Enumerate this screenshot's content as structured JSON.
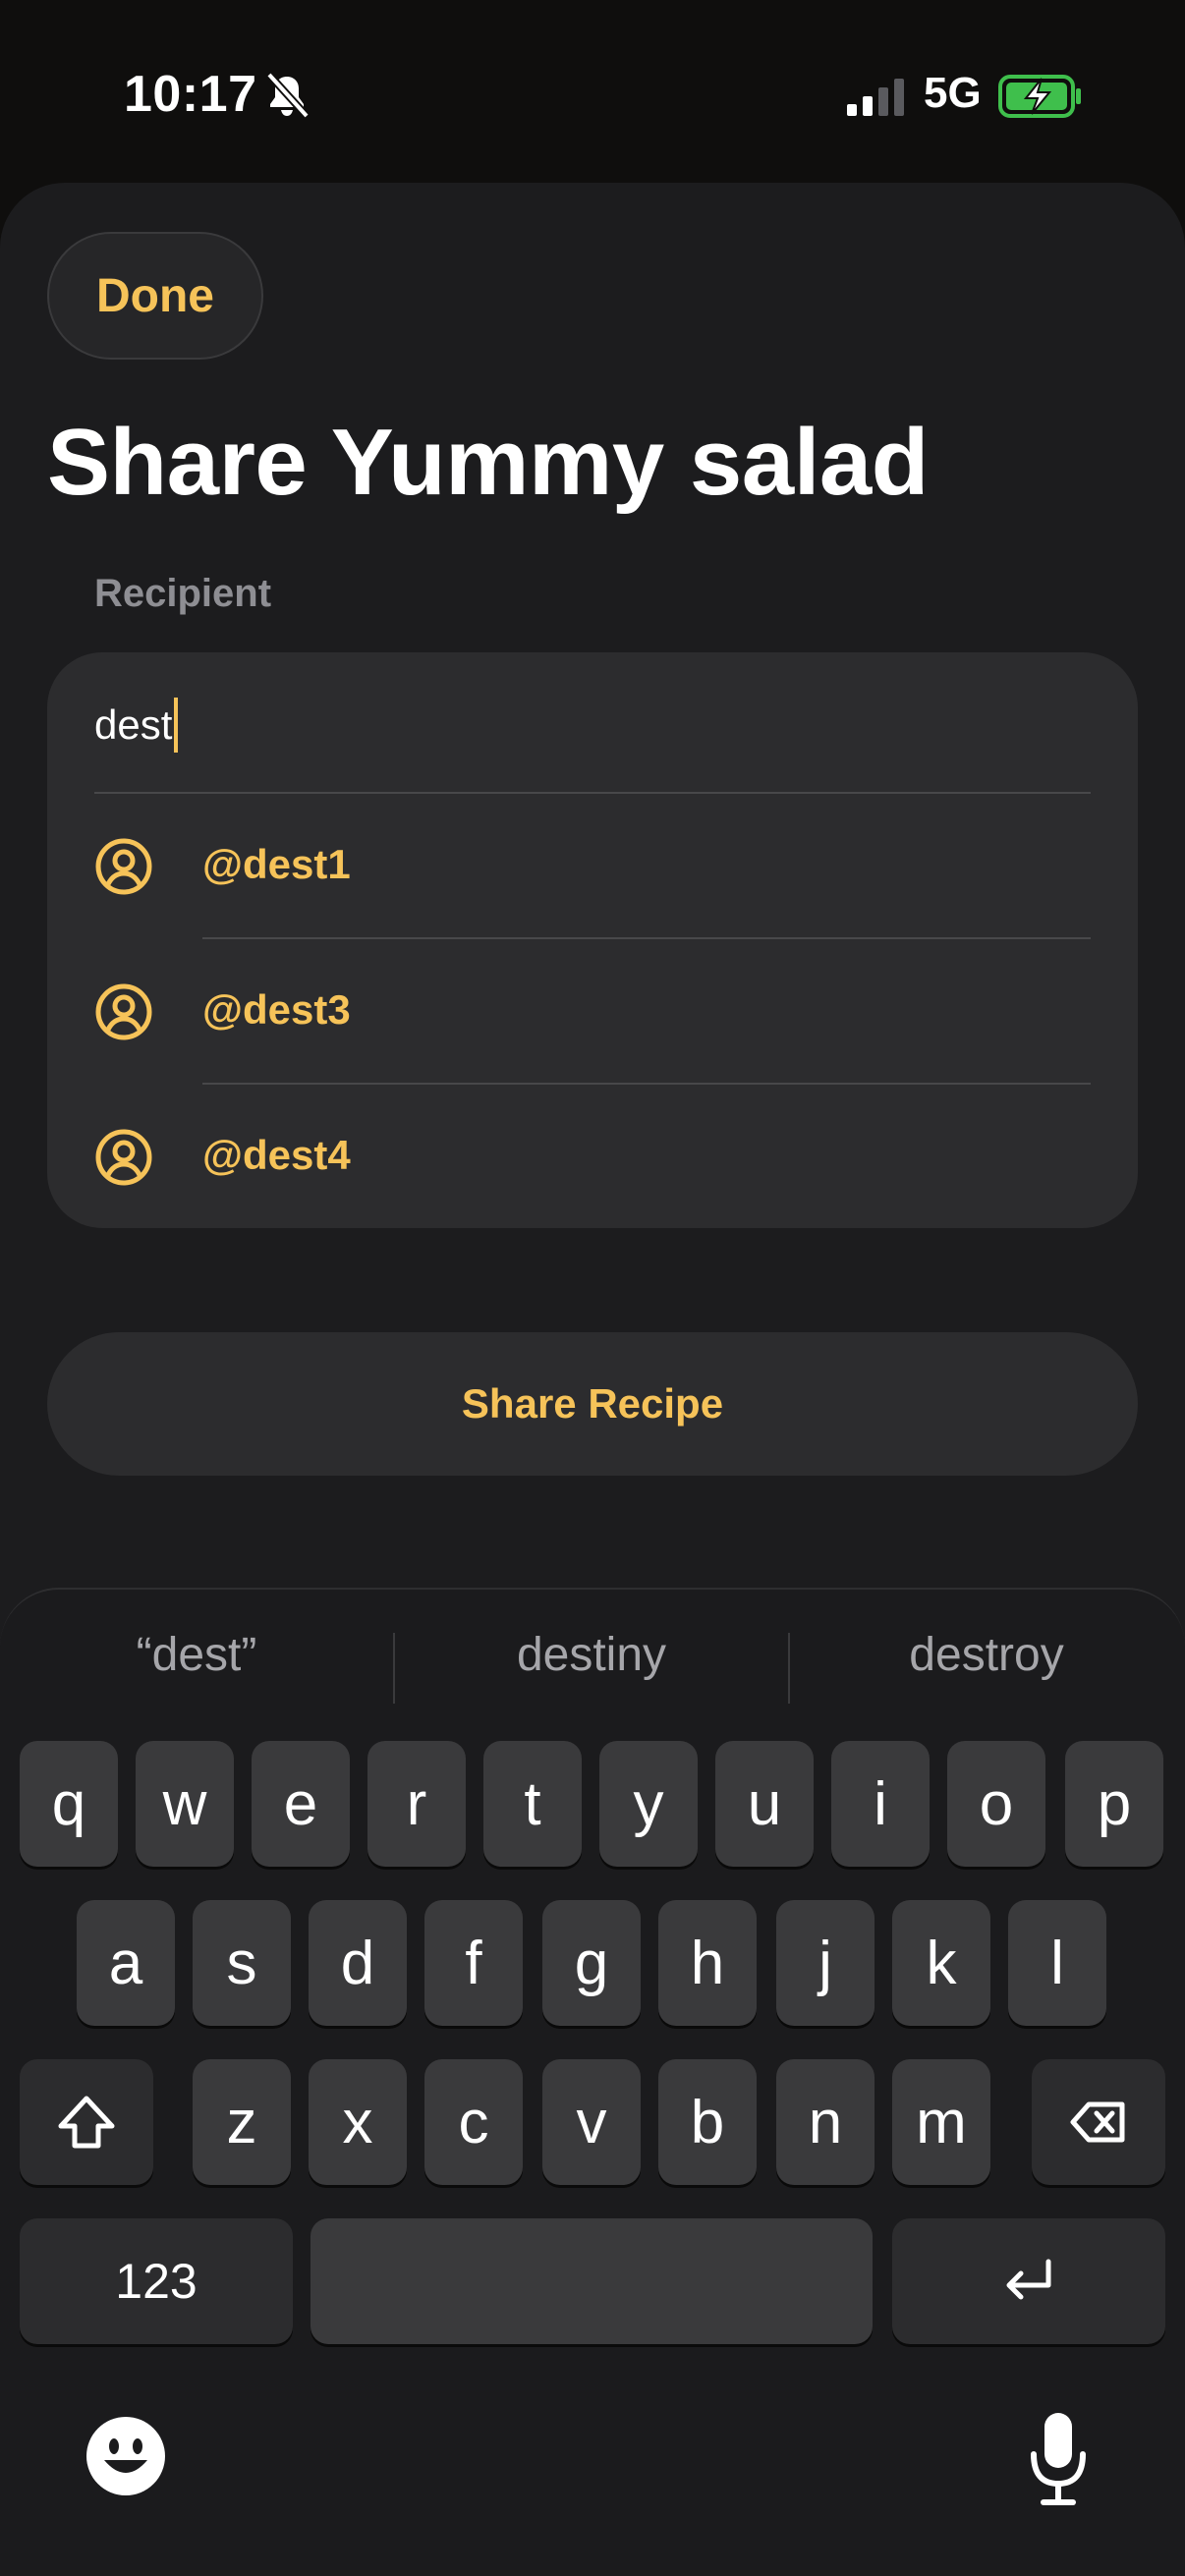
{
  "status": {
    "time": "10:17",
    "network": "5G"
  },
  "header": {
    "done_label": "Done",
    "title": "Share Yummy salad"
  },
  "recipient": {
    "section_label": "Recipient",
    "input_value": "dest",
    "suggestions": [
      "@dest1",
      "@dest3",
      "@dest4"
    ]
  },
  "share_button_label": "Share Recipe",
  "keyboard": {
    "suggestions": [
      "“dest”",
      "destiny",
      "destroy"
    ],
    "row1": [
      "q",
      "w",
      "e",
      "r",
      "t",
      "y",
      "u",
      "i",
      "o",
      "p"
    ],
    "row2": [
      "a",
      "s",
      "d",
      "f",
      "g",
      "h",
      "j",
      "k",
      "l"
    ],
    "row3": [
      "z",
      "x",
      "c",
      "v",
      "b",
      "n",
      "m"
    ],
    "numbers_label": "123"
  },
  "colors": {
    "accent": "#f6c359",
    "background": "#1c1c1e",
    "card": "#2c2c2e"
  }
}
